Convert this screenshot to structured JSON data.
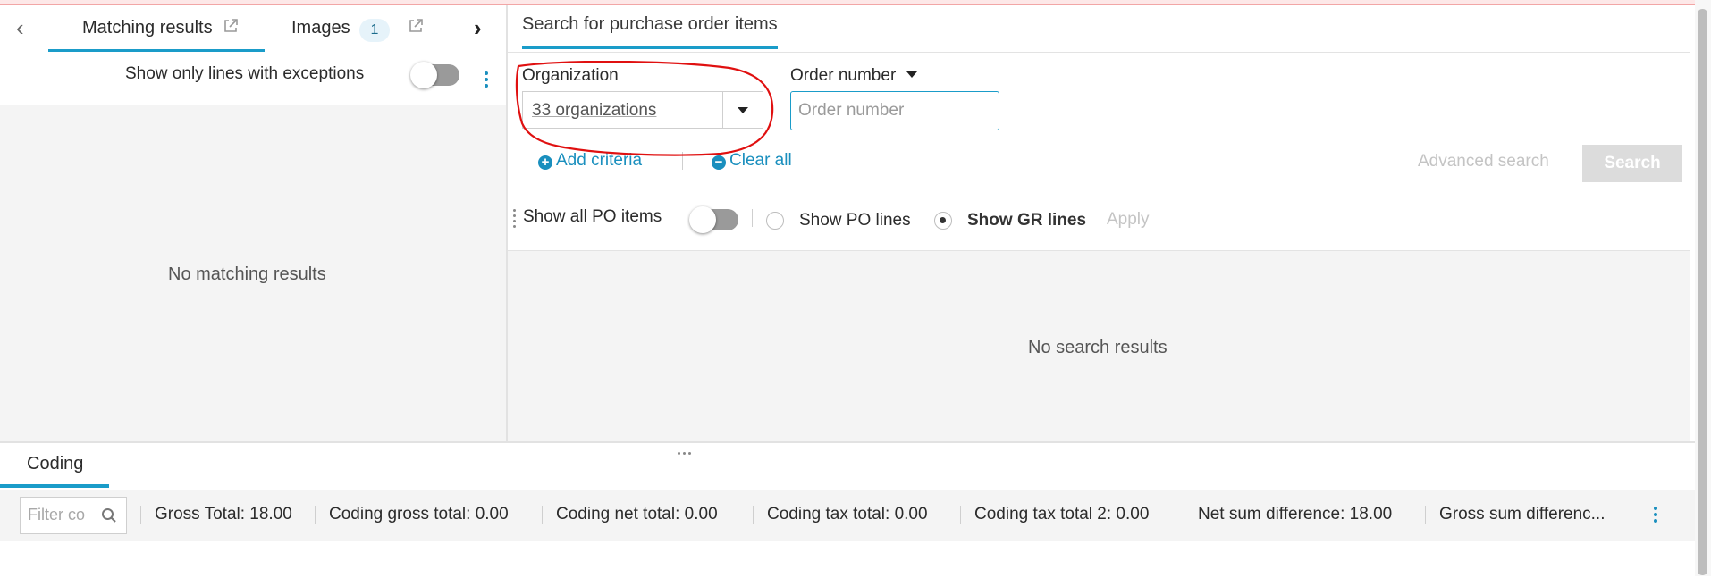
{
  "left": {
    "tabs": [
      {
        "label": "Matching results"
      },
      {
        "label": "Images",
        "badge": "1"
      }
    ],
    "show_exceptions_label": "Show only lines with exceptions",
    "empty_text": "No matching results"
  },
  "right": {
    "tab_label": "Search for purchase order items",
    "organization": {
      "label": "Organization",
      "value": "33 organizations"
    },
    "order_number": {
      "label": "Order number",
      "placeholder": "Order number"
    },
    "add_criteria": "Add criteria",
    "clear_all": "Clear all",
    "advanced_search": "Advanced search",
    "search": "Search",
    "show_all_po_items": "Show all PO items",
    "show_po_lines": "Show PO lines",
    "show_gr_lines": "Show GR lines",
    "apply": "Apply",
    "empty_text": "No search results"
  },
  "bottom": {
    "tab_label": "Coding",
    "filter_placeholder": "Filter co",
    "totals": [
      "Gross Total: 18.00",
      "Coding gross total: 0.00",
      "Coding net total: 0.00",
      "Coding tax total: 0.00",
      "Coding tax total 2: 0.00",
      "Net sum difference: 18.00",
      "Gross sum differenc..."
    ]
  },
  "colors": {
    "accent": "#1a9cc9",
    "annotation": "#e01010"
  }
}
